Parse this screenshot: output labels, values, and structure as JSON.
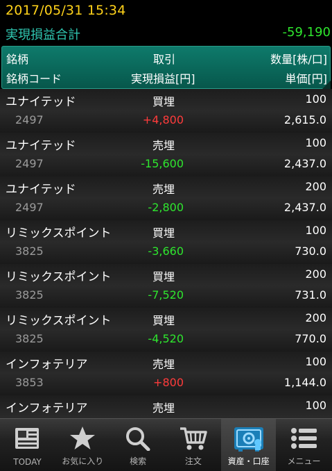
{
  "status": {
    "datetime": "2017/05/31   15:34",
    "summary_label": "実現損益合計",
    "summary_value": "-59,190"
  },
  "header": {
    "col1_top": "銘柄",
    "col2_top": "取引",
    "col3_top": "数量[株/口]",
    "col1_bottom": "銘柄コード",
    "col2_bottom": "実現損益[円]",
    "col3_bottom": "単価[円]"
  },
  "rows": [
    {
      "name": "ユナイテッド",
      "trade": "買埋",
      "qty": "100",
      "code": "2497",
      "pnl": "+4,800",
      "price": "2,615.0",
      "sign": "pos"
    },
    {
      "name": "ユナイテッド",
      "trade": "売埋",
      "qty": "100",
      "code": "2497",
      "pnl": "-15,600",
      "price": "2,437.0",
      "sign": "neg"
    },
    {
      "name": "ユナイテッド",
      "trade": "売埋",
      "qty": "200",
      "code": "2497",
      "pnl": "-2,800",
      "price": "2,437.0",
      "sign": "neg"
    },
    {
      "name": "リミックスポイント",
      "trade": "買埋",
      "qty": "100",
      "code": "3825",
      "pnl": "-3,660",
      "price": "730.0",
      "sign": "neg"
    },
    {
      "name": "リミックスポイント",
      "trade": "買埋",
      "qty": "200",
      "code": "3825",
      "pnl": "-7,520",
      "price": "731.0",
      "sign": "neg"
    },
    {
      "name": "リミックスポイント",
      "trade": "買埋",
      "qty": "200",
      "code": "3825",
      "pnl": "-4,520",
      "price": "770.0",
      "sign": "neg"
    },
    {
      "name": "インフォテリア",
      "trade": "売埋",
      "qty": "100",
      "code": "3853",
      "pnl": "+800",
      "price": "1,144.0",
      "sign": "pos"
    },
    {
      "name": "インフォテリア",
      "trade": "売埋",
      "qty": "100",
      "code": "",
      "pnl": "",
      "price": "",
      "sign": "neg"
    }
  ],
  "tabs": [
    {
      "label": "TODAY",
      "icon": "newspaper-icon"
    },
    {
      "label": "お気に入り",
      "icon": "star-icon"
    },
    {
      "label": "検索",
      "icon": "search-icon"
    },
    {
      "label": "注文",
      "icon": "cart-icon"
    },
    {
      "label": "資産・口座",
      "icon": "safe-icon",
      "active": true
    },
    {
      "label": "メニュー",
      "icon": "menu-icon"
    }
  ],
  "colors": {
    "positive": "#ff3b3b",
    "negative": "#2ee62e",
    "accent": "#ffd21a",
    "teal": "#2fc6b0"
  }
}
